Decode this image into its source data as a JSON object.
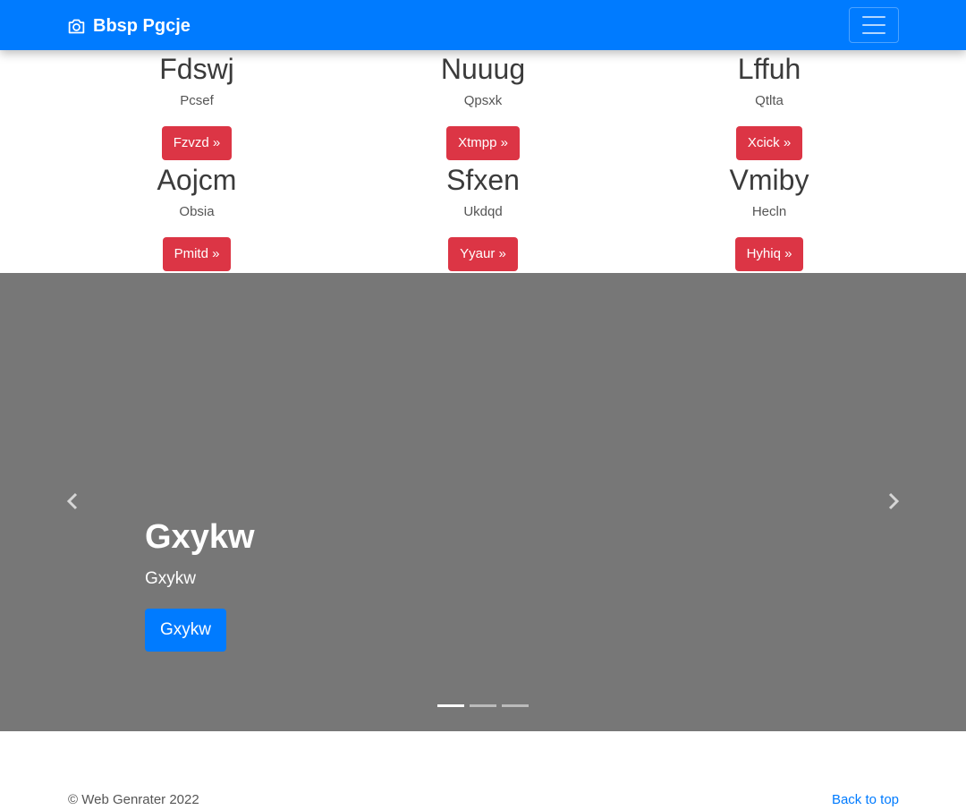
{
  "navbar": {
    "brand": "Bbsp Pgcje",
    "brand_icon": "camera-icon",
    "toggler_icon": "hamburger-menu-icon",
    "color": "#007bff"
  },
  "features": [
    {
      "title": "Fdswj",
      "text": "Pcsef",
      "button": "Fzvzd »"
    },
    {
      "title": "Nuuug",
      "text": "Qpsxk",
      "button": "Xtmpp »"
    },
    {
      "title": "Lffuh",
      "text": "Qtlta",
      "button": "Xcick »"
    },
    {
      "title": "Aojcm",
      "text": "Obsia",
      "button": "Pmitd »"
    },
    {
      "title": "Sfxen",
      "text": "Ukdqd",
      "button": "Yyaur »"
    },
    {
      "title": "Vmiby",
      "text": "Hecln",
      "button": "Hyhiq »"
    }
  ],
  "feature_button_color": "#dc3545",
  "carousel": {
    "background": "#777777",
    "prev_icon": "chevron-left-icon",
    "next_icon": "chevron-right-icon",
    "caption": {
      "title": "Gxykw",
      "text": "Gxykw",
      "button": "Gxykw"
    },
    "slide_count": 3,
    "active_slide": 1
  },
  "footer": {
    "copyright": "© Web Genrater 2022",
    "back_to_top": "Back to top"
  }
}
